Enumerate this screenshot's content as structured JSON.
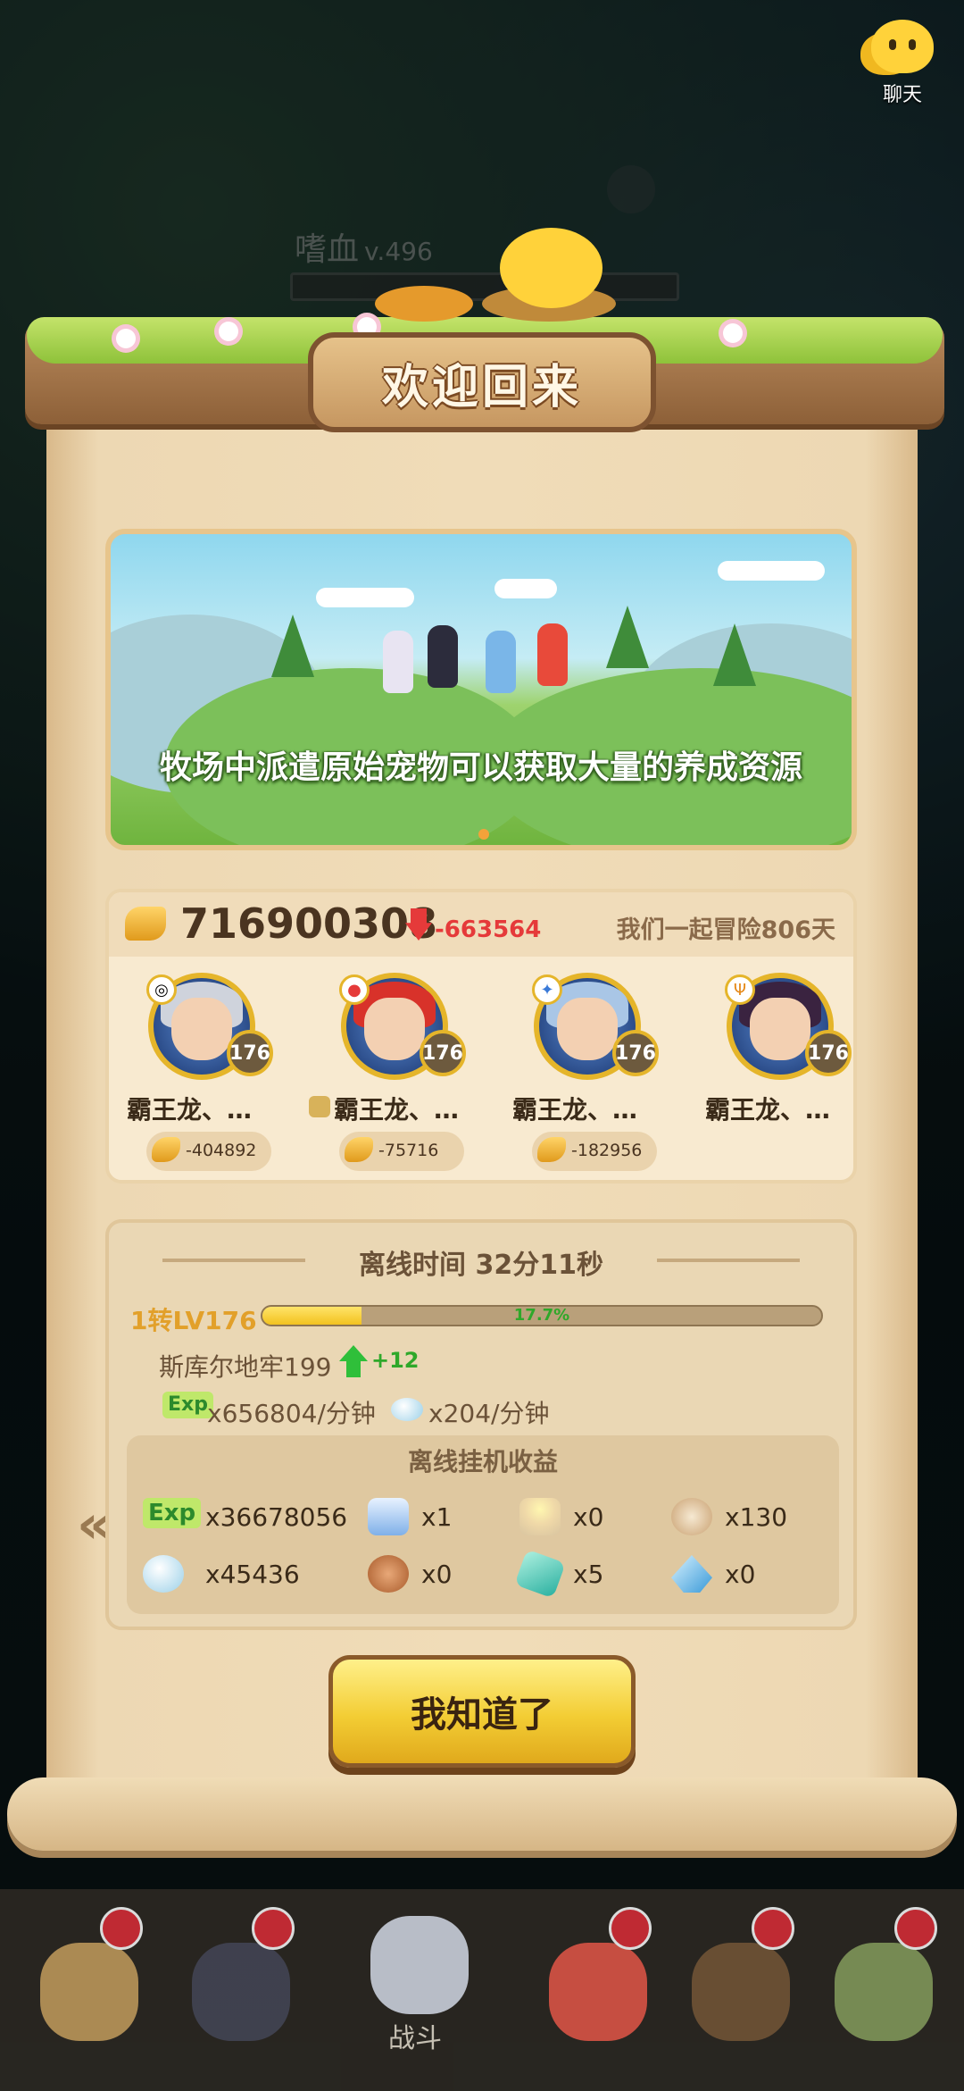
{
  "chat": {
    "label": "聊天"
  },
  "background_hud": {
    "player_name": "嗜血",
    "level": "v.496"
  },
  "dialog": {
    "title": "欢迎回来",
    "banner": {
      "caption": "牧场中派遣原始宠物可以获取大量的养成资源"
    },
    "summary": {
      "gold_total": "716900308",
      "gold_change": "-663564",
      "adventure_days": "我们一起冒险806天",
      "pets": [
        {
          "name": "霸王龙、…",
          "level": "176",
          "gold_change": "-404892",
          "element_icon": "purple-swirl-icon",
          "hair": "#cfd3dc"
        },
        {
          "name": "霸王龙、…",
          "level": "176",
          "gold_change": "-75716",
          "element_icon": "red-fire-icon",
          "hair": "#d8322a"
        },
        {
          "name": "霸王龙、…",
          "level": "176",
          "gold_change": "-182956",
          "element_icon": "blue-wind-icon",
          "hair": "#a9c6e6"
        },
        {
          "name": "霸王龙、…",
          "level": "176",
          "gold_change": "",
          "element_icon": "trident-icon",
          "hair": "#3a2340"
        }
      ]
    },
    "offline": {
      "title": "离线时间 32分11秒",
      "level_label": "1转LV176",
      "progress_percent": 17.7,
      "progress_text": "17.7%",
      "dungeon": "斯库尔地牢199",
      "dungeon_gain": "+12",
      "exp_icon_label": "Exp",
      "exp_rate": "x656804/分钟",
      "stone_rate": "x204/分钟",
      "rewards_title": "离线挂机收益",
      "rewards": [
        {
          "icon": "exp-icon",
          "value": "x36678056"
        },
        {
          "icon": "blue-crystal-box-icon",
          "value": "x1"
        },
        {
          "icon": "candle-icon",
          "value": "x0"
        },
        {
          "icon": "medal-icon",
          "value": "x130"
        },
        {
          "icon": "spirit-stone-icon",
          "value": "x45436"
        },
        {
          "icon": "meat-icon",
          "value": "x0"
        },
        {
          "icon": "green-gem-icon",
          "value": "x5"
        },
        {
          "icon": "ice-crystal-icon",
          "value": "x0"
        }
      ]
    },
    "confirm_label": "我知道了"
  },
  "bottom_nav": {
    "battle_label": "战斗"
  },
  "colors": {
    "gold": "#e2a02a",
    "loss": "#e53a3a",
    "gain": "#2fa82a",
    "parchment": "#f0dcb8"
  }
}
